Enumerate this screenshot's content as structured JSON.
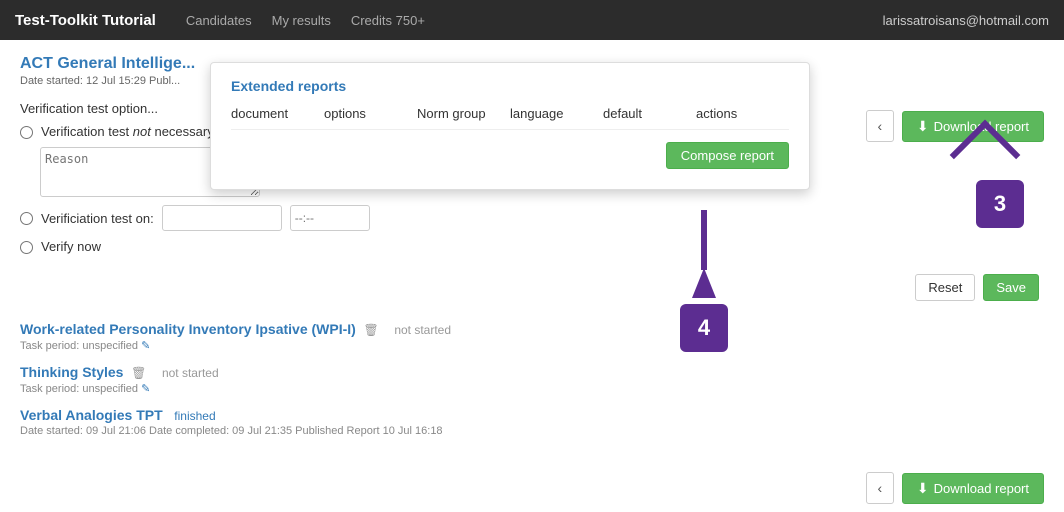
{
  "app": {
    "title": "Test-Toolkit Tutorial",
    "nav_links": [
      "Candidates",
      "My results",
      "Credits 750+"
    ],
    "user": "larissatroisans@hotmail.com"
  },
  "section": {
    "title": "ACT General Intellige...",
    "date_started": "Date started: 12 Jul 15:29 Publ...",
    "verification_label": "Verification test option..."
  },
  "verification": {
    "option_not_necessary": "Verification test not necessary",
    "reason_placeholder": "Reason",
    "option_on": "Verificiation test on:",
    "option_verify_now": "Verify now",
    "time_placeholder": "--:--"
  },
  "buttons": {
    "reset": "Reset",
    "save": "Save",
    "download_report": "Download report",
    "back": "‹",
    "compose_report": "Compose report"
  },
  "tasks": [
    {
      "title": "Work-related Personality Inventory Ipsative (WPI-I)",
      "status": "not started",
      "period": "Task period: unspecified"
    },
    {
      "title": "Thinking Styles",
      "status": "not started",
      "period": "Task period: unspecified"
    },
    {
      "title": "Verbal Analogies TPT",
      "status": "finished",
      "meta": "Date started: 09 Jul 21:06 Date completed: 09 Jul 21:35 Published Report 10 Jul 16:18"
    }
  ],
  "popup": {
    "title": "Extended reports",
    "columns": [
      "document",
      "options",
      "Norm group",
      "language",
      "default",
      "actions"
    ]
  },
  "annotations": {
    "box3": "3",
    "box4": "4"
  }
}
